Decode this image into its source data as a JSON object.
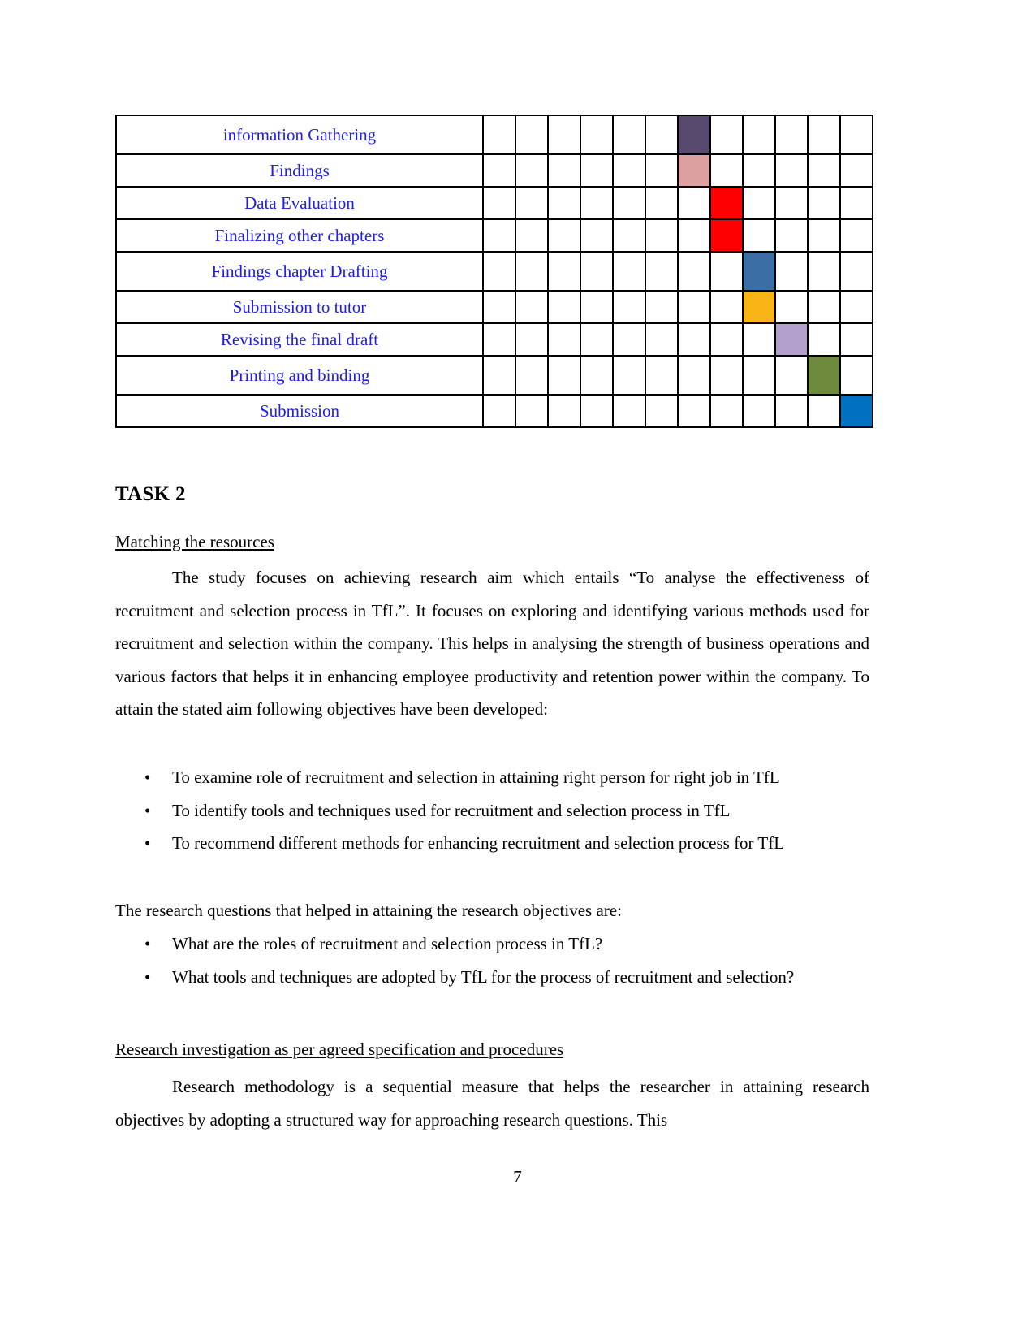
{
  "gantt": {
    "columns": 12,
    "rows": [
      {
        "label": "information Gathering",
        "fill_column": 6,
        "color": "#574A6E",
        "height": "tall"
      },
      {
        "label": "Findings",
        "fill_column": 6,
        "color": "#DCA0A0",
        "height": "short"
      },
      {
        "label": "Data Evaluation",
        "fill_column": 7,
        "color": "#FF0000",
        "height": "short"
      },
      {
        "label": "Finalizing other chapters",
        "fill_column": 7,
        "color": "#FF0000",
        "height": "short"
      },
      {
        "label": "Findings chapter Drafting",
        "fill_column": 8,
        "color": "#3A6EA5",
        "height": "tall"
      },
      {
        "label": "Submission to tutor",
        "fill_column": 8,
        "color": "#F9B416",
        "height": "short"
      },
      {
        "label": "Revising the final draft",
        "fill_column": 9,
        "color": "#B3A0CC",
        "height": "short"
      },
      {
        "label": "Printing and binding",
        "fill_column": 10,
        "color": "#6E8B3D",
        "height": "tall"
      },
      {
        "label": "Submission",
        "fill_column": 11,
        "color": "#0070C0",
        "height": "short"
      }
    ]
  },
  "task_heading": "TASK 2",
  "section_1": {
    "heading": "Matching the resources",
    "paragraph": "The study focuses on achieving research aim which entails “To analyse the effectiveness of  recruitment and selection process in TfL”. It focuses on exploring and identifying various methods used for recruitment and selection within the company. This helps in analysing the strength of business operations and various factors that helps it in enhancing employee productivity and retention power within the company. To attain the stated aim following objectives have been developed:",
    "objectives": [
      "To examine role of recruitment and selection in attaining right person for right job in TfL",
      "To identify tools and techniques used for recruitment and selection process in TfL",
      "To recommend different methods for enhancing recruitment and selection process for TfL"
    ],
    "questions_intro": "The research questions that helped in attaining the research objectives are:",
    "questions": [
      "What are the roles of recruitment and selection process in TfL?",
      "What tools and techniques are adopted by TfL for the process of recruitment and selection?"
    ]
  },
  "section_2": {
    "heading": "Research investigation as per agreed specification and procedures",
    "paragraph": "Research methodology is a sequential measure that helps the researcher in attaining research objectives by adopting a structured way for approaching research questions. This"
  },
  "bullet_glyph": "•",
  "page_number": "7"
}
